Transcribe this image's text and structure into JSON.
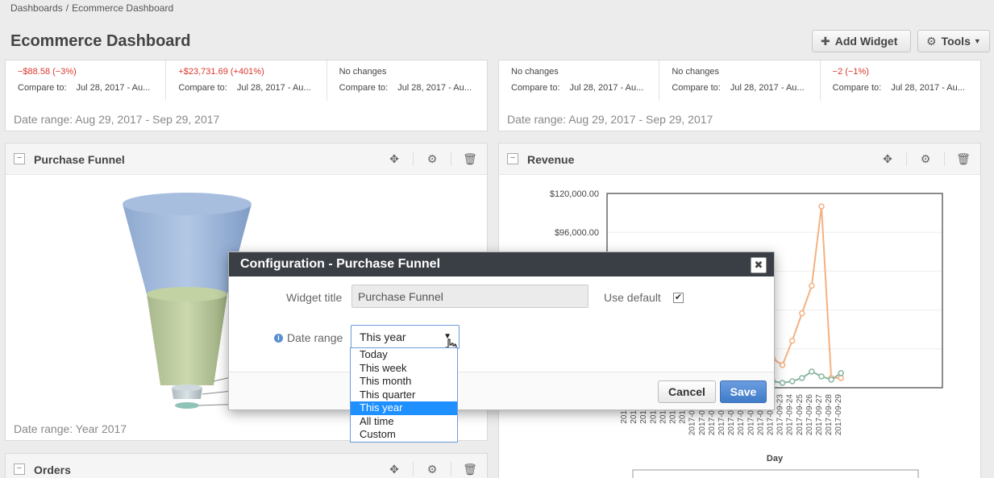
{
  "breadcrumb": [
    "Dashboards",
    "/",
    "Ecommerce Dashboard"
  ],
  "page_title": "Ecommerce Dashboard",
  "toolbar": {
    "add_widget": "Add Widget",
    "tools": "Tools"
  },
  "kpi_left": [
    {
      "change": "−$88.58 (−3%)",
      "compare_label": "Compare to:",
      "compare_value": "Jul 28, 2017 - Au..."
    },
    {
      "change": "+$23,731.69 (+401%)",
      "compare_label": "Compare to:",
      "compare_value": "Jul 28, 2017 - Au..."
    },
    {
      "change": "No changes",
      "compare_label": "Compare to:",
      "compare_value": "Jul 28, 2017 - Au..."
    }
  ],
  "kpi_right": [
    {
      "change": "No changes",
      "compare_label": "Compare to:",
      "compare_value": "Jul 28, 2017 - Au..."
    },
    {
      "change": "No changes",
      "compare_label": "Compare to:",
      "compare_value": "Jul 28, 2017 - Au..."
    },
    {
      "change": "−2 (−1%)",
      "compare_label": "Compare to:",
      "compare_value": "Jul 28, 2017 - Au..."
    }
  ],
  "kpi_left_daterange": "Date range: Aug 29, 2017 - Sep 29, 2017",
  "kpi_right_daterange": "Date range: Aug 29, 2017 - Sep 29, 2017",
  "funnel_widget": {
    "title": "Purchase Funnel",
    "daterange": "Date range: Year 2017"
  },
  "revenue_widget": {
    "title": "Revenue"
  },
  "orders_widget": {
    "title": "Orders"
  },
  "chart_data": {
    "type": "line",
    "xlabel": "Day",
    "ylabel": "",
    "y_tick_labels": [
      "$120,000.00",
      "$96,000.00"
    ],
    "x_tick_labels": [
      "2017-08",
      "2017-09",
      "2017-09",
      "2017-09",
      "2017-09",
      "2017-09",
      "2017-09",
      "2017-09-14",
      "2017-09-15",
      "2017-09-16",
      "2017-09-17",
      "2017-09-18",
      "2017-09-19",
      "2017-09-20",
      "2017-09-21",
      "2017-09-22",
      "2017-09-23",
      "2017-09-24",
      "2017-09-25",
      "2017-09-26",
      "2017-09-27",
      "2017-09-28",
      "2017-09-29"
    ],
    "series": [
      {
        "color": "#f4b183",
        "values": [
          14000,
          13000,
          12000,
          11000,
          12000,
          14000,
          13000,
          16000,
          14000,
          12000,
          9000,
          15000,
          15000,
          16000,
          36000,
          18000,
          14000,
          29000,
          46000,
          63000,
          112000,
          6000,
          6000
        ]
      },
      {
        "color": "#8ab7a0",
        "values": [
          3000,
          3000,
          3000,
          3000,
          3000,
          3000,
          3000,
          4000,
          3000,
          3000,
          3000,
          3000,
          4000,
          6000,
          4000,
          4000,
          3000,
          4000,
          6000,
          10000,
          7000,
          5000,
          9000
        ]
      }
    ]
  },
  "dialog": {
    "title": "Configuration - Purchase Funnel",
    "close_glyph": "✖",
    "widget_title_label": "Widget title",
    "widget_title_value": "Purchase Funnel",
    "use_default_label": "Use default",
    "use_default_checked": "✔",
    "date_range_label": "Date range",
    "date_range_value": "This year",
    "cancel": "Cancel",
    "save": "Save"
  },
  "date_range_options": [
    "Today",
    "This week",
    "This month",
    "This quarter",
    "This year",
    "All time",
    "Custom"
  ],
  "selected_option_index": 4
}
